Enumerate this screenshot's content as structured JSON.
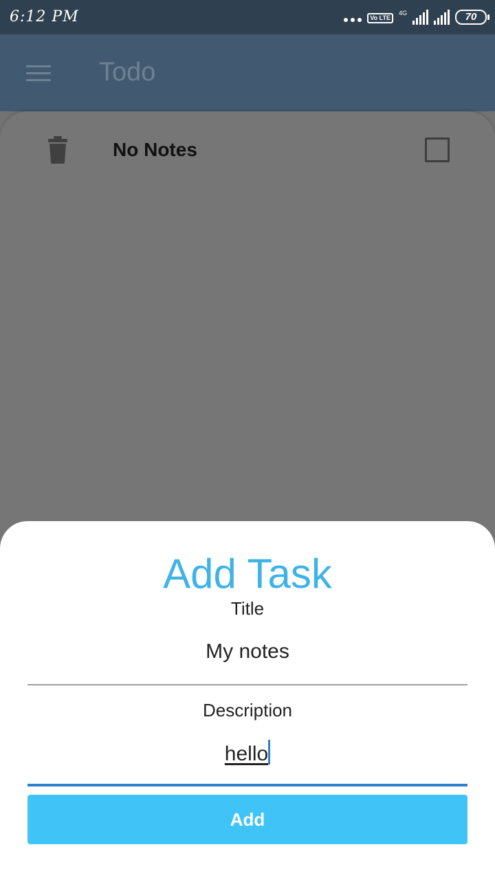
{
  "status_bar": {
    "time": "6:12 PM",
    "volte_label": "Vo LTE",
    "network_label": "4G",
    "battery_level": "70"
  },
  "app_bar": {
    "title": "Todo"
  },
  "list": {
    "empty_text": "No Notes"
  },
  "sheet": {
    "heading": "Add Task",
    "title_label": "Title",
    "title_value": "My notes",
    "description_label": "Description",
    "description_value": "hello",
    "add_button": "Add"
  },
  "colors": {
    "accent": "#3fb3e6",
    "button": "#40c4f7",
    "app_bar": "#425a71",
    "status_bar": "#2f4050",
    "focus_line": "#2f7fd1"
  }
}
